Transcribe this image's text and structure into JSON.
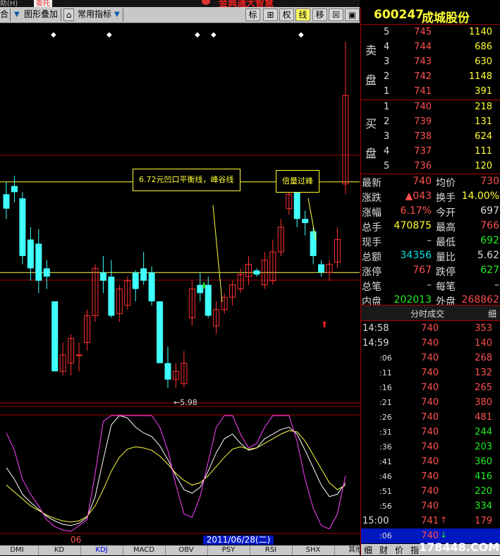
{
  "topstrip": {
    "left_text": "助(H)",
    "pill": "委托",
    "title": "金典通大智慧"
  },
  "toolbar": {
    "prefix": "合",
    "overlay_label": "图形叠加",
    "indicator_label": "常用指标",
    "buttons": [
      {
        "label": "标",
        "active": false
      },
      {
        "label": "⊞",
        "active": false
      },
      {
        "label": "权",
        "active": false
      },
      {
        "label": "线",
        "active": true
      },
      {
        "label": "移",
        "active": false
      },
      {
        "label": "☒",
        "active": false
      },
      {
        "label": "▣",
        "active": false
      }
    ]
  },
  "stock": {
    "code": "600247",
    "name": "成城股份"
  },
  "orderbook": {
    "sell_label_1": "卖",
    "sell_label_2": "盘",
    "buy_label_1": "买",
    "buy_label_2": "盘",
    "sell": [
      {
        "level": "5",
        "price": "745",
        "volume": "1140"
      },
      {
        "level": "4",
        "price": "744",
        "volume": "686"
      },
      {
        "level": "3",
        "price": "743",
        "volume": "630"
      },
      {
        "level": "2",
        "price": "742",
        "volume": "1148"
      },
      {
        "level": "1",
        "price": "741",
        "volume": "391"
      }
    ],
    "buy": [
      {
        "level": "1",
        "price": "740",
        "volume": "218"
      },
      {
        "level": "2",
        "price": "739",
        "volume": "131"
      },
      {
        "level": "3",
        "price": "738",
        "volume": "624"
      },
      {
        "level": "4",
        "price": "737",
        "volume": "111"
      },
      {
        "level": "5",
        "price": "736",
        "volume": "120"
      }
    ]
  },
  "quote": [
    {
      "l1": "最新",
      "v1": "740",
      "c1": "red",
      "l2": "均价",
      "v2": "730",
      "c2": "red"
    },
    {
      "l1": "涨跌",
      "v1": "▲043",
      "c1": "red",
      "l2": "换手",
      "v2": "14.00%",
      "c2": "yel"
    },
    {
      "l1": "涨幅",
      "v1": "6.17%",
      "c1": "red",
      "l2": "今开",
      "v2": "697",
      "c2": "wht"
    },
    {
      "l1": "总手",
      "v1": "470875",
      "c1": "yel",
      "l2": "最高",
      "v2": "766",
      "c2": "red"
    },
    {
      "l1": "现手",
      "v1": "–",
      "c1": "wht",
      "l2": "最低",
      "v2": "692",
      "c2": "green"
    },
    {
      "l1": "总额",
      "v1": "34356",
      "c1": "cyan",
      "l2": "量比",
      "v2": "5.62",
      "c2": "wht"
    },
    {
      "l1": "涨停",
      "v1": "767",
      "c1": "red",
      "l2": "跌停",
      "v2": "627",
      "c2": "green"
    },
    {
      "l1": "总笔",
      "v1": "–",
      "c1": "wht",
      "l2": "每笔",
      "v2": "–",
      "c2": "wht"
    },
    {
      "l1": "内盘",
      "v1": "202013",
      "c1": "green",
      "l2": "外盘",
      "v2": "268862",
      "c2": "red"
    }
  ],
  "ticks_header": {
    "title": "分时成交",
    "right": "细"
  },
  "ticks": [
    {
      "time": "14:58",
      "short": false,
      "price": "740",
      "arrow": "",
      "volume": "353",
      "vc": "red"
    },
    {
      "time": "14:59",
      "short": false,
      "price": "740",
      "arrow": "",
      "volume": "140",
      "vc": "red"
    },
    {
      "time": ":06",
      "short": true,
      "price": "740",
      "arrow": "",
      "volume": "268",
      "vc": "red"
    },
    {
      "time": ":11",
      "short": true,
      "price": "740",
      "arrow": "",
      "volume": "132",
      "vc": "red"
    },
    {
      "time": ":16",
      "short": true,
      "price": "740",
      "arrow": "",
      "volume": "265",
      "vc": "red"
    },
    {
      "time": ":21",
      "short": true,
      "price": "740",
      "arrow": "",
      "volume": "380",
      "vc": "red"
    },
    {
      "time": ":26",
      "short": true,
      "price": "740",
      "arrow": "",
      "volume": "481",
      "vc": "red"
    },
    {
      "time": ":31",
      "short": true,
      "price": "740",
      "arrow": "",
      "volume": "244",
      "vc": "green"
    },
    {
      "time": ":36",
      "short": true,
      "price": "740",
      "arrow": "",
      "volume": "203",
      "vc": "green"
    },
    {
      "time": ":41",
      "short": true,
      "price": "740",
      "arrow": "",
      "volume": "360",
      "vc": "green"
    },
    {
      "time": ":46",
      "short": true,
      "price": "740",
      "arrow": "",
      "volume": "416",
      "vc": "green"
    },
    {
      "time": ":51",
      "short": true,
      "price": "740",
      "arrow": "",
      "volume": "220",
      "vc": "green"
    },
    {
      "time": ":56",
      "short": true,
      "price": "740",
      "arrow": "",
      "volume": "334",
      "vc": "green"
    },
    {
      "time": "15:00",
      "short": false,
      "price": "741",
      "arrow": "↑",
      "volume": "179",
      "vc": "red"
    },
    {
      "time": ":06",
      "short": true,
      "price": "740",
      "arrow": "↓",
      "volume": "",
      "vc": "green"
    }
  ],
  "rp_tabs": [
    "细",
    "财",
    "价",
    "指"
  ],
  "watermark": "178448.COM",
  "bottom_tabs": [
    "DMI",
    "KD",
    "KDJ",
    "MACD",
    "OBV",
    "PSY",
    "RSI",
    "SHX",
    "其他"
  ],
  "bottom_active": "KDJ",
  "chart_labels": {
    "date": "2011/06/28(二)",
    "month": "06",
    "low_label": "←5.98",
    "note1": "6.72元凹口平衡线，峰谷线",
    "note2": "倍量过峰"
  },
  "colors": {
    "up": "#ff3030",
    "down": "#40ffff",
    "line": "#ffff40",
    "grid": "#a00000"
  },
  "chart_data": {
    "type": "candlestick",
    "title": "",
    "ohlc": [
      [
        6.92,
        6.98,
        6.8,
        6.85
      ],
      [
        6.96,
        7.01,
        6.88,
        6.93
      ],
      [
        6.9,
        6.93,
        6.58,
        6.62
      ],
      [
        6.7,
        6.76,
        6.5,
        6.56
      ],
      [
        6.68,
        6.75,
        6.44,
        6.5
      ],
      [
        6.56,
        6.6,
        6.46,
        6.52
      ],
      [
        6.4,
        6.4,
        6.06,
        6.06
      ],
      [
        6.06,
        6.2,
        6.04,
        6.14
      ],
      [
        6.1,
        6.24,
        6.04,
        6.22
      ],
      [
        6.14,
        6.2,
        6.06,
        6.14
      ],
      [
        6.2,
        6.36,
        6.16,
        6.33
      ],
      [
        6.33,
        6.58,
        6.3,
        6.56
      ],
      [
        6.54,
        6.62,
        6.44,
        6.5
      ],
      [
        6.52,
        6.6,
        6.32,
        6.33
      ],
      [
        6.34,
        6.48,
        6.3,
        6.46
      ],
      [
        6.38,
        6.52,
        6.36,
        6.5
      ],
      [
        6.54,
        6.55,
        6.4,
        6.46
      ],
      [
        6.56,
        6.64,
        6.48,
        6.5
      ],
      [
        6.54,
        6.57,
        6.38,
        6.4
      ],
      [
        6.4,
        6.4,
        6.1,
        6.1
      ],
      [
        6.1,
        6.18,
        5.98,
        6.02
      ],
      [
        6.02,
        6.1,
        5.98,
        6.06
      ],
      [
        6.0,
        6.16,
        5.98,
        6.1
      ],
      [
        6.32,
        6.5,
        6.28,
        6.46
      ],
      [
        6.48,
        6.54,
        6.4,
        6.44
      ],
      [
        6.48,
        6.52,
        6.32,
        6.33
      ],
      [
        6.28,
        6.4,
        6.24,
        6.36
      ],
      [
        6.36,
        6.44,
        6.34,
        6.42
      ],
      [
        6.42,
        6.5,
        6.38,
        6.48
      ],
      [
        6.46,
        6.56,
        6.44,
        6.53
      ],
      [
        6.52,
        6.62,
        6.48,
        6.58
      ],
      [
        6.55,
        6.56,
        6.52,
        6.53
      ],
      [
        6.48,
        6.64,
        6.46,
        6.6
      ],
      [
        6.5,
        6.7,
        6.48,
        6.64
      ],
      [
        6.64,
        6.8,
        6.62,
        6.76
      ],
      [
        6.85,
        6.96,
        6.82,
        6.92
      ],
      [
        6.93,
        7.0,
        6.76,
        6.8
      ],
      [
        6.8,
        6.84,
        6.72,
        6.78
      ],
      [
        6.74,
        6.76,
        6.58,
        6.62
      ],
      [
        6.58,
        6.6,
        6.52,
        6.54
      ],
      [
        6.54,
        6.6,
        6.5,
        6.58
      ],
      [
        6.59,
        6.76,
        6.56,
        6.7
      ],
      [
        6.97,
        7.66,
        6.92,
        7.4
      ]
    ],
    "xlabel": "",
    "ylabel": "",
    "ylim": [
      5.9,
      7.75
    ],
    "hlines": [
      6.98,
      6.54
    ],
    "kdj": {
      "k": [
        0.55,
        0.45,
        0.32,
        0.25,
        0.19,
        0.13,
        0.09,
        0.06,
        0.05,
        0.07,
        0.12,
        0.3,
        0.62,
        0.92,
        1.0,
        0.98,
        0.9,
        0.85,
        0.82,
        0.74,
        0.62,
        0.48,
        0.36,
        0.33,
        0.38,
        0.52,
        0.68,
        0.8,
        0.84,
        0.76,
        0.7,
        0.72,
        0.8,
        0.84,
        0.88,
        0.9,
        0.84,
        0.7,
        0.55,
        0.4,
        0.3,
        0.32,
        0.42
      ],
      "d": [
        0.4,
        0.34,
        0.28,
        0.22,
        0.18,
        0.14,
        0.11,
        0.09,
        0.08,
        0.09,
        0.13,
        0.22,
        0.36,
        0.52,
        0.64,
        0.71,
        0.73,
        0.72,
        0.7,
        0.65,
        0.58,
        0.5,
        0.44,
        0.4,
        0.42,
        0.48,
        0.56,
        0.64,
        0.71,
        0.73,
        0.71,
        0.72,
        0.76,
        0.8,
        0.84,
        0.87,
        0.86,
        0.78,
        0.66,
        0.54,
        0.42,
        0.36,
        0.4
      ],
      "j": [
        0.85,
        0.7,
        0.45,
        0.32,
        0.22,
        0.1,
        0.04,
        0.01,
        0.0,
        0.05,
        0.1,
        0.5,
        0.95,
        1.0,
        1.0,
        1.0,
        1.0,
        1.0,
        1.0,
        0.9,
        0.7,
        0.4,
        0.15,
        0.12,
        0.3,
        0.6,
        0.9,
        1.0,
        1.0,
        0.84,
        0.72,
        0.76,
        0.9,
        1.0,
        1.0,
        1.0,
        0.78,
        0.45,
        0.2,
        0.05,
        0.02,
        0.15,
        0.48
      ]
    }
  }
}
